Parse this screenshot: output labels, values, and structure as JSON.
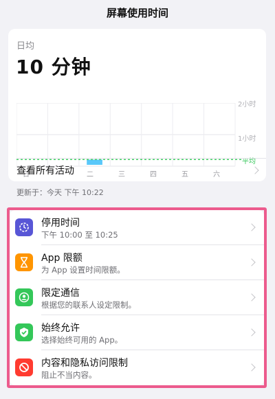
{
  "nav": {
    "title": "屏幕使用时间"
  },
  "summary": {
    "label": "日均",
    "value": "10 分钟",
    "see_all": "查看所有活动"
  },
  "chart_data": {
    "type": "bar",
    "categories": [
      "日",
      "一",
      "二",
      "三",
      "四",
      "五",
      "六"
    ],
    "values": [
      0,
      0,
      10,
      0,
      0,
      0,
      0
    ],
    "y_unit": "minutes",
    "ylim": [
      0,
      150
    ],
    "y_ticks": [
      "2小时",
      "1小时"
    ],
    "average_label": "平均",
    "average_value": 10,
    "bar_color": "#5ac8fa",
    "average_color": "#34c759",
    "grid": true
  },
  "updated": "更新于：今天 下午 10:22",
  "settings": [
    {
      "title": "停用时间",
      "subtitle": "下午 10:00 至 10:25",
      "icon": "moon-clock-icon",
      "color": "#5856d6"
    },
    {
      "title": "App 限额",
      "subtitle": "为 App 设置时间限额。",
      "icon": "hourglass-icon",
      "color": "#ff9500"
    },
    {
      "title": "限定通信",
      "subtitle": "根据您的联系人设定限制。",
      "icon": "person-circle-icon",
      "color": "#34c759"
    },
    {
      "title": "始终允许",
      "subtitle": "选择始终可用的 App。",
      "icon": "checkmark-shield-icon",
      "color": "#34c759"
    },
    {
      "title": "内容和隐私访问限制",
      "subtitle": "阻止不当内容。",
      "icon": "restriction-icon",
      "color": "#ff3b30"
    }
  ],
  "highlight_color": "#ec5b8d"
}
